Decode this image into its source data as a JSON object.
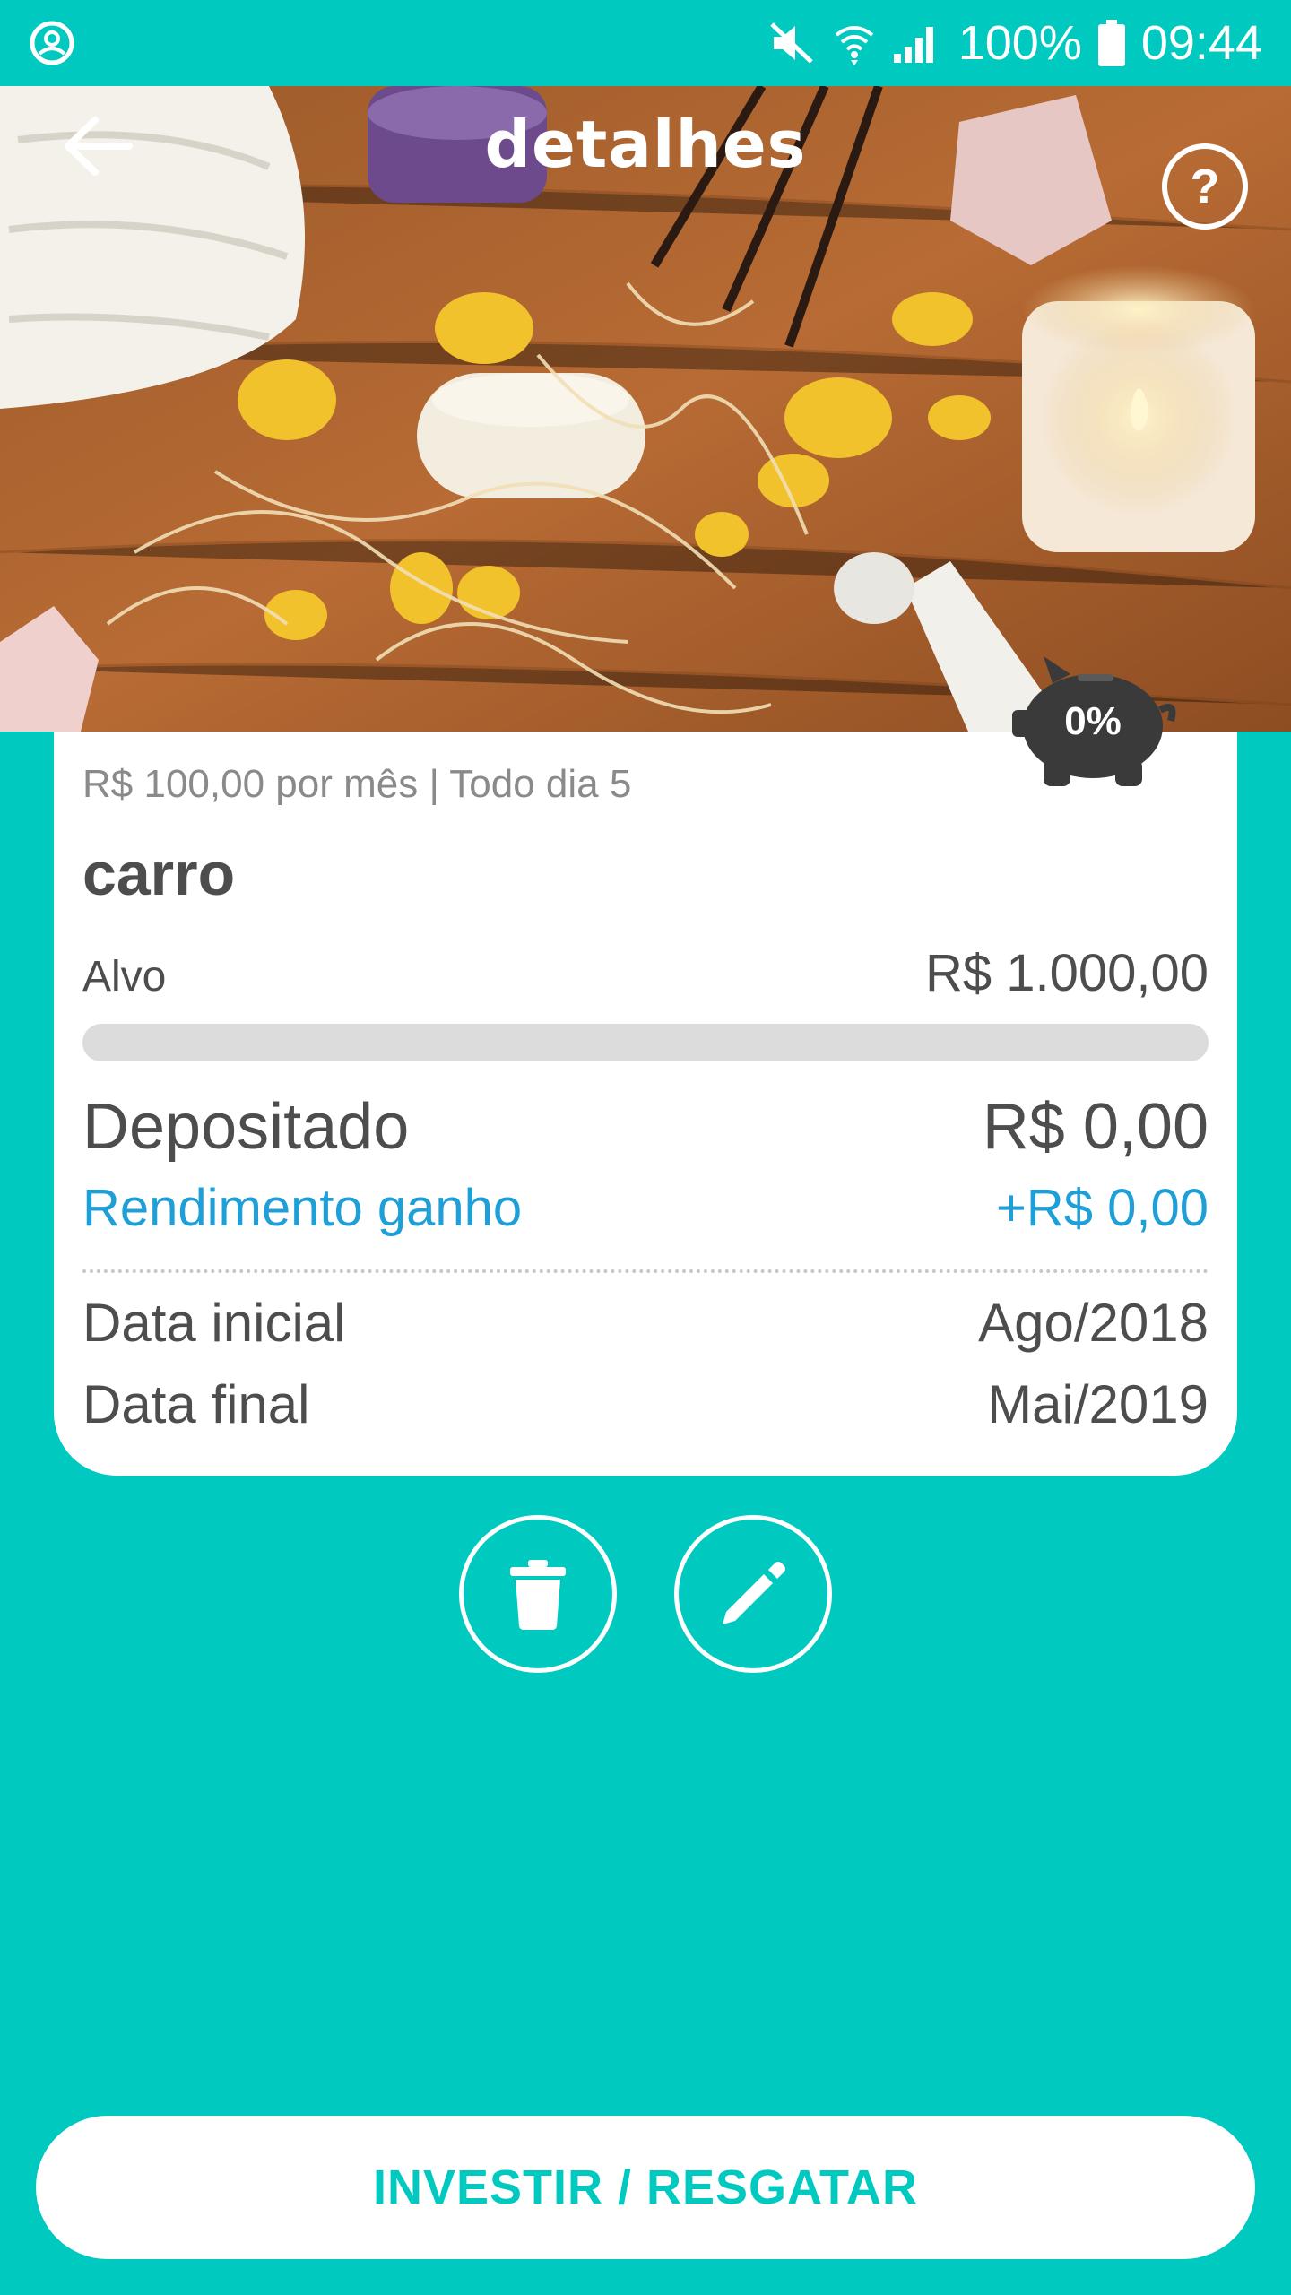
{
  "status_bar": {
    "battery": "100%",
    "time": "09:44",
    "icons": [
      "account-circle-icon",
      "mute-icon",
      "wifi-icon",
      "signal-icon",
      "battery-icon"
    ]
  },
  "header": {
    "title": "detalhes",
    "help_label": "?"
  },
  "goal": {
    "schedule": "R$ 100,00 por mês | Todo dia 5",
    "name": "carro",
    "target_label": "Alvo",
    "target_value": "R$ 1.000,00",
    "progress": 0,
    "progress_label": "0%",
    "deposited_label": "Depositado",
    "deposited_value": "R$ 0,00",
    "earnings_label": "Rendimento ganho",
    "earnings_value": "+R$ 0,00",
    "start_label": "Data inicial",
    "start_value": "Ago/2018",
    "end_label": "Data final",
    "end_value": "Mai/2019"
  },
  "actions": {
    "invest_label": "INVESTIR / RESGATAR"
  },
  "colors": {
    "accent": "#00C9C0",
    "earnings": "#1e9fd8",
    "text": "#4d4d4d",
    "piggy": "#3a3a3a"
  }
}
